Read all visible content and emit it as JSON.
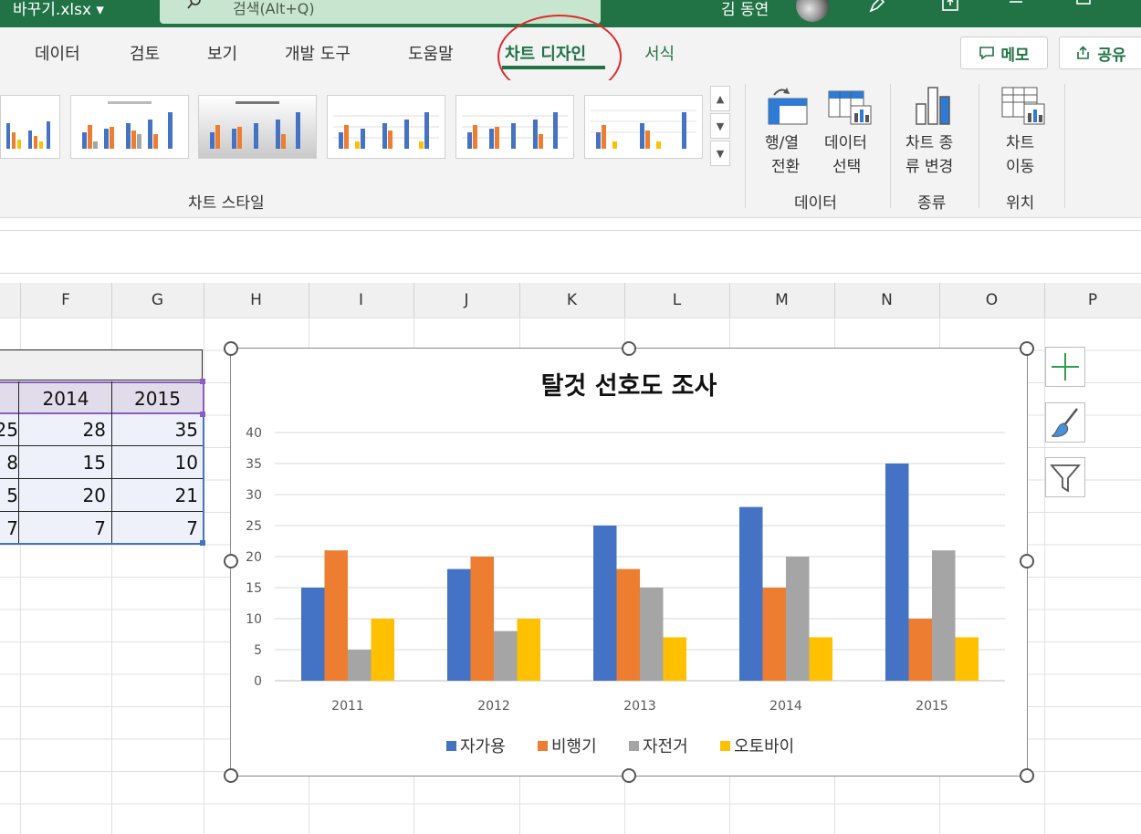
{
  "titlebar": {
    "filename": "바꾸기.xlsx",
    "search_placeholder": "검색(Alt+Q)",
    "username": "김 동연"
  },
  "tabs": [
    {
      "label": "데이터",
      "active": false
    },
    {
      "label": "검토",
      "active": false
    },
    {
      "label": "보기",
      "active": false
    },
    {
      "label": "개발 도구",
      "active": false
    },
    {
      "label": "도움말",
      "active": false
    },
    {
      "label": "차트 디자인",
      "active": true
    },
    {
      "label": "서식",
      "active": false
    }
  ],
  "top_buttons": {
    "memo": "메모",
    "share": "공유"
  },
  "ribbon": {
    "chart_styles_label": "차트 스타일",
    "data_group": {
      "label": "데이터",
      "switch_line1": "행/열",
      "switch_line2": "전환",
      "select_line1": "데이터",
      "select_line2": "선택"
    },
    "type_group": {
      "label": "종류",
      "change_line1": "차트 종",
      "change_line2": "류 변경"
    },
    "location_group": {
      "label": "위치",
      "move_line1": "차트",
      "move_line2": "이동"
    }
  },
  "columns": [
    "F",
    "G",
    "H",
    "I",
    "J",
    "K",
    "L",
    "M",
    "N",
    "O",
    "P"
  ],
  "table": {
    "headers": [
      "2014",
      "2015"
    ],
    "rows": [
      {
        "partial": "25",
        "c2014": "28",
        "c2015": "35"
      },
      {
        "partial": "8",
        "c2014": "15",
        "c2015": "10"
      },
      {
        "partial": "5",
        "c2014": "20",
        "c2015": "21"
      },
      {
        "partial": "7",
        "c2014": "7",
        "c2015": "7"
      }
    ]
  },
  "colors": {
    "accent": "#217346",
    "series": [
      "#4472C4",
      "#ED7D31",
      "#A5A5A5",
      "#FFC000"
    ]
  },
  "chart_data": {
    "type": "bar",
    "title": "탈것 선호도 조사",
    "categories": [
      "2011",
      "2012",
      "2013",
      "2014",
      "2015"
    ],
    "series": [
      {
        "name": "자가용",
        "values": [
          15,
          18,
          25,
          28,
          35
        ]
      },
      {
        "name": "비행기",
        "values": [
          21,
          20,
          18,
          15,
          10
        ]
      },
      {
        "name": "자전거",
        "values": [
          5,
          8,
          15,
          20,
          21
        ]
      },
      {
        "name": "오토바이",
        "values": [
          10,
          10,
          7,
          7,
          7
        ]
      }
    ],
    "yticks": [
      "0",
      "5",
      "10",
      "15",
      "20",
      "25",
      "30",
      "35",
      "40"
    ],
    "ylim": [
      0,
      40
    ],
    "grid": true,
    "legend": "bottom"
  }
}
